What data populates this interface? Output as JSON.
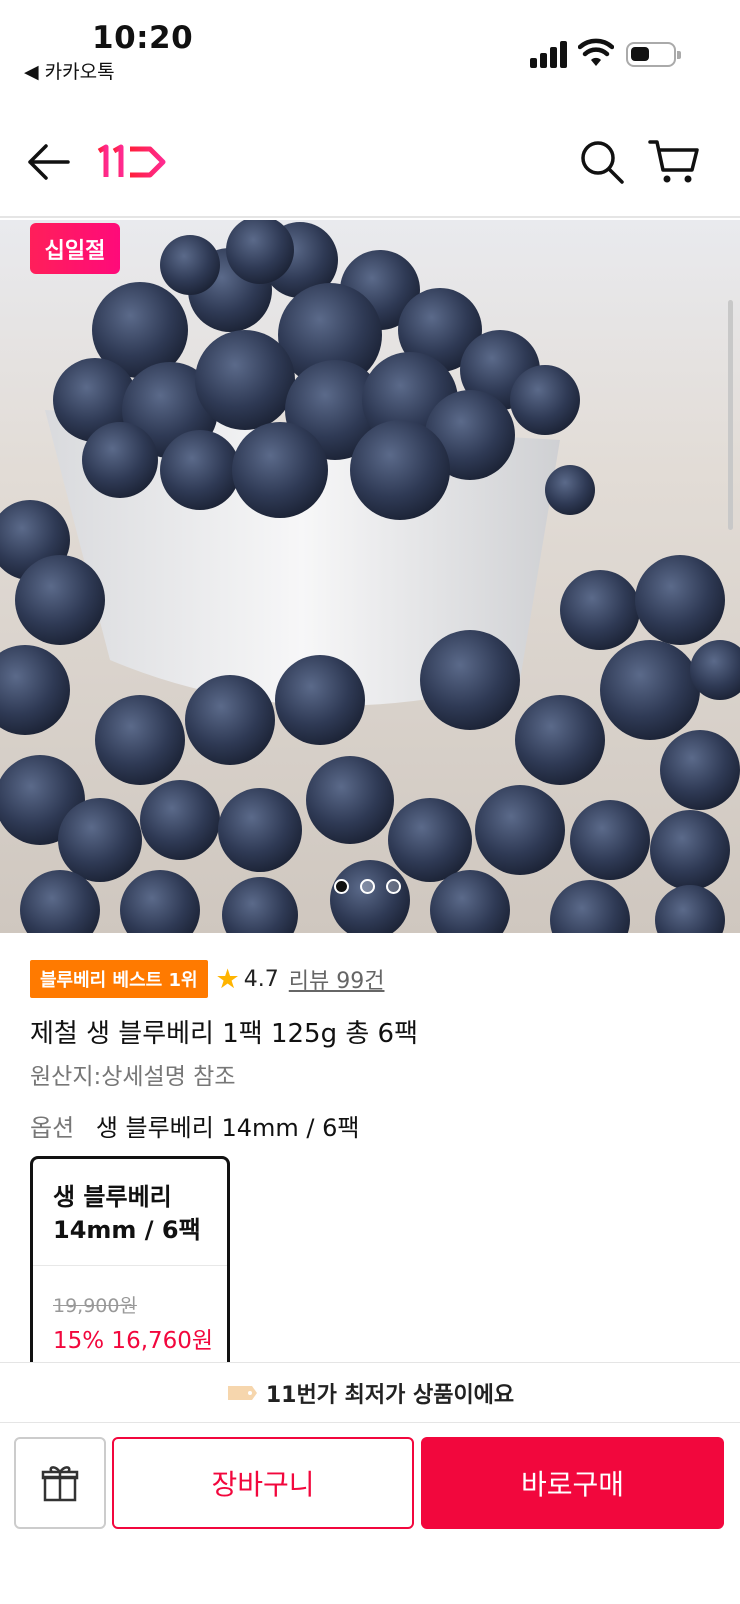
{
  "status_bar": {
    "time": "10:20",
    "back_app": "◀ 카카오톡"
  },
  "header": {
    "logo_text": "11"
  },
  "hero": {
    "badge": "십일절",
    "image_alt": "blueberries in a white bowl",
    "slides": 3,
    "active_slide": 1
  },
  "product": {
    "best_badge": "블루베리 베스트 1위",
    "rating": "4.7",
    "review": "리뷰 99건",
    "title": "제철 생 블루베리 1팩 125g 총 6팩",
    "origin": "원산지:상세설명 참조",
    "option_label": "옵션",
    "option_value": "생 블루베리 14mm / 6팩"
  },
  "option_card": {
    "name": "생 블루베리 14mm / 6팩",
    "original_price": "19,900원",
    "sale_price": "15% 16,760원"
  },
  "lowest_banner": {
    "text": "11번가 최저가 상품이에요"
  },
  "bottom_bar": {
    "cart_label": "장바구니",
    "buy_label": "바로구매"
  },
  "colors": {
    "accent": "#f2073d",
    "best_badge": "#ff7a00",
    "star": "#ffb400"
  }
}
